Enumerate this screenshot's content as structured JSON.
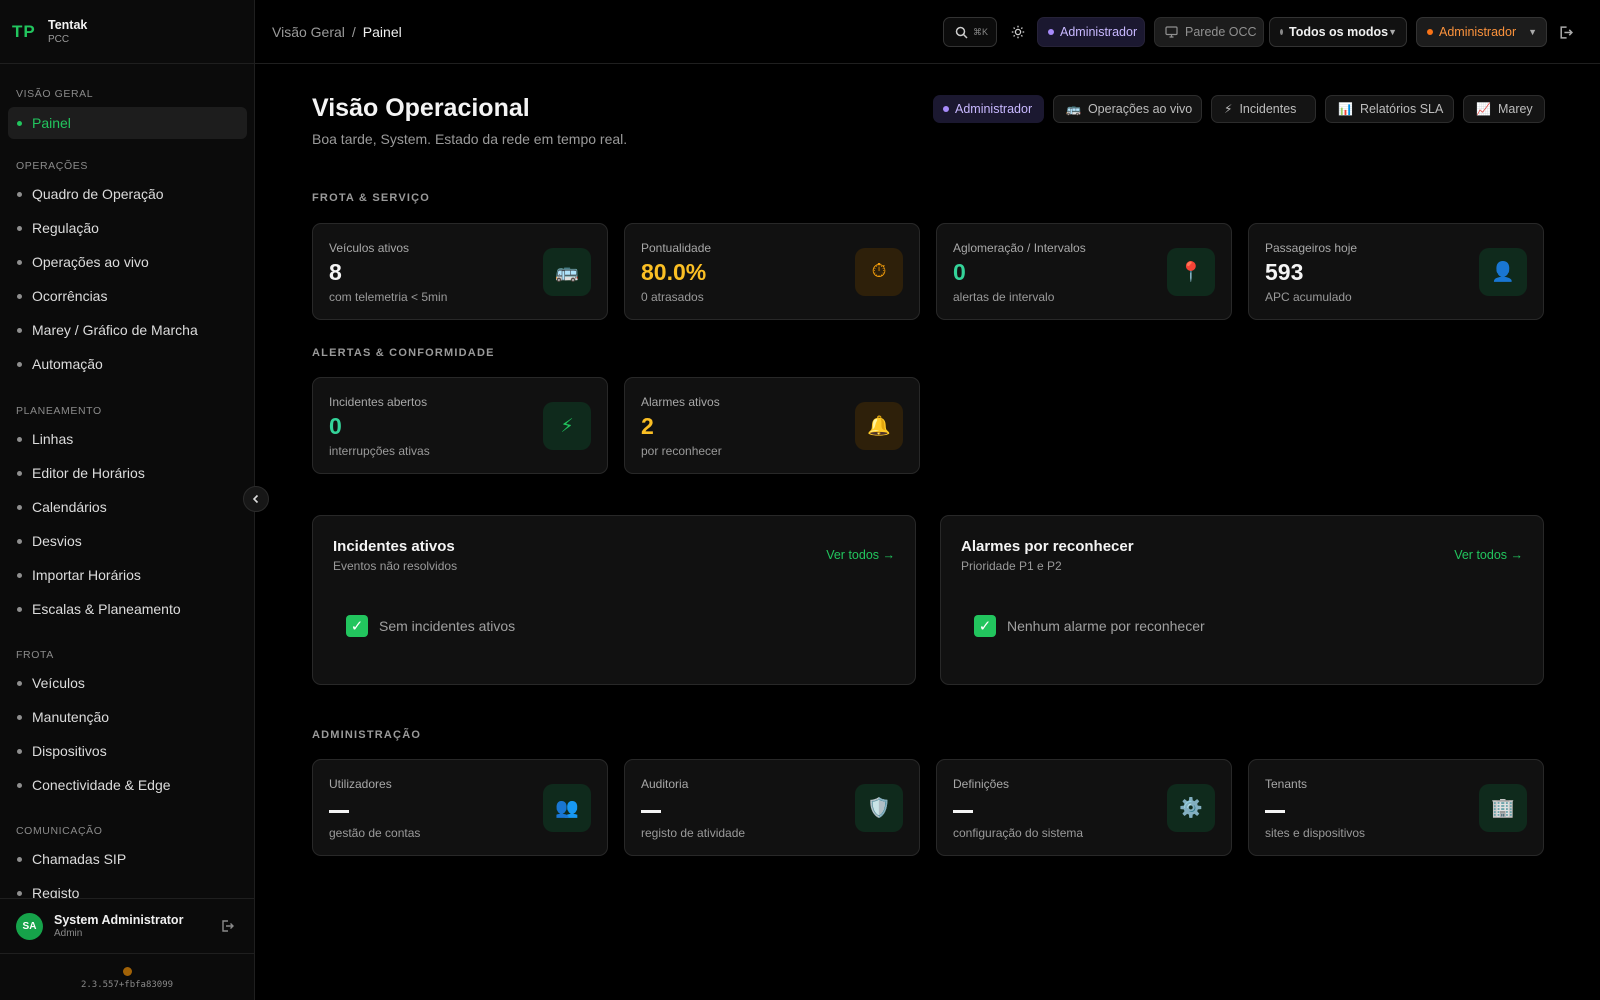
{
  "brand": {
    "logo": "TP",
    "name": "Tentak",
    "sub": "PCC"
  },
  "sidebar": {
    "sections": [
      {
        "title": "VISÃO GERAL",
        "items": [
          "Painel"
        ]
      },
      {
        "title": "OPERAÇÕES",
        "items": [
          "Quadro de Operação",
          "Regulação",
          "Operações ao vivo",
          "Ocorrências",
          "Marey / Gráfico de Marcha",
          "Automação"
        ]
      },
      {
        "title": "PLANEAMENTO",
        "items": [
          "Linhas",
          "Editor de Horários",
          "Calendários",
          "Desvios",
          "Importar Horários",
          "Escalas & Planeamento"
        ]
      },
      {
        "title": "FROTA",
        "items": [
          "Veículos",
          "Manutenção",
          "Dispositivos",
          "Conectividade & Edge"
        ]
      },
      {
        "title": "COMUNICAÇÃO",
        "items": [
          "Chamadas SIP",
          "Registo"
        ]
      }
    ],
    "active": "Painel",
    "user": {
      "initials": "SA",
      "name": "System Administrator",
      "role": "Admin"
    },
    "version": "2.3.557+fbfa83099"
  },
  "topbar": {
    "breadcrumb": {
      "parent": "Visão Geral",
      "separator": "/",
      "current": "Painel"
    },
    "search_shortcut": "⌘K",
    "role_badge": "Administrador",
    "wall_button": "Parede OCC",
    "modes_select": "Todos os modos",
    "role_select": "Administrador"
  },
  "page": {
    "title": "Visão Operacional",
    "subtitle": "Boa tarde, System. Estado da rede em tempo real.",
    "role_badge": "Administrador",
    "quick_actions": [
      {
        "label": "Operações ao vivo",
        "icon": "🚌"
      },
      {
        "label": "Incidentes",
        "icon": "⚡"
      },
      {
        "label": "Relatórios SLA",
        "icon": "📊"
      },
      {
        "label": "Marey",
        "icon": "📈"
      }
    ]
  },
  "fleet": {
    "title": "FROTA & SERVIÇO",
    "cards": [
      {
        "label": "Veículos ativos",
        "value": "8",
        "sub": "com telemetria < 5min",
        "icon": "🚌"
      },
      {
        "label": "Pontualidade",
        "value": "80.0%",
        "sub": "0 atrasados",
        "icon": "⏱"
      },
      {
        "label": "Aglomeração / Intervalos",
        "value": "0",
        "sub": "alertas de intervalo",
        "icon": "📍"
      },
      {
        "label": "Passageiros hoje",
        "value": "593",
        "sub": "APC acumulado",
        "icon": "👤"
      }
    ]
  },
  "alerts": {
    "title": "ALERTAS & CONFORMIDADE",
    "cards": [
      {
        "label": "Incidentes abertos",
        "value": "0",
        "sub": "interrupções ativas",
        "icon": "⚡"
      },
      {
        "label": "Alarmes ativos",
        "value": "2",
        "sub": "por reconhecer",
        "icon": "🔔"
      }
    ]
  },
  "panels": [
    {
      "title": "Incidentes ativos",
      "sub": "Eventos não resolvidos",
      "link": "Ver todos →",
      "empty": "Sem incidentes ativos"
    },
    {
      "title": "Alarmes por reconhecer",
      "sub": "Prioridade P1 e P2",
      "link": "Ver todos →",
      "empty": "Nenhum alarme por reconhecer"
    }
  ],
  "admin": {
    "title": "ADMINISTRAÇÃO",
    "cards": [
      {
        "label": "Utilizadores",
        "sub": "gestão de contas",
        "icon": "👥"
      },
      {
        "label": "Auditoria",
        "sub": "registo de atividade",
        "icon": "🛡️"
      },
      {
        "label": "Definições",
        "sub": "configuração do sistema",
        "icon": "⚙️"
      },
      {
        "label": "Tenants",
        "sub": "sites e dispositivos",
        "icon": "🏢"
      }
    ]
  },
  "colors": {
    "accent": "#22c55e",
    "amber": "#fbbf24",
    "violet": "#a78bfa",
    "orange": "#fb923c"
  }
}
